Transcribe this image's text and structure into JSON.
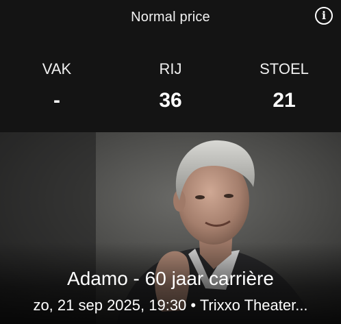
{
  "header": {
    "price_label": "Normal price",
    "info_icon": "info-icon"
  },
  "seat": {
    "columns": [
      {
        "label": "VAK",
        "value": "-"
      },
      {
        "label": "RIJ",
        "value": "36"
      },
      {
        "label": "STOEL",
        "value": "21"
      }
    ]
  },
  "event": {
    "image_subject": "portrait of performer",
    "title": "Adamo - 60 jaar carrière",
    "details": "zo, 21 sep 2025, 19:30 • Trixxo Theater..."
  },
  "colors": {
    "background": "#141414",
    "text": "#ffffff"
  }
}
